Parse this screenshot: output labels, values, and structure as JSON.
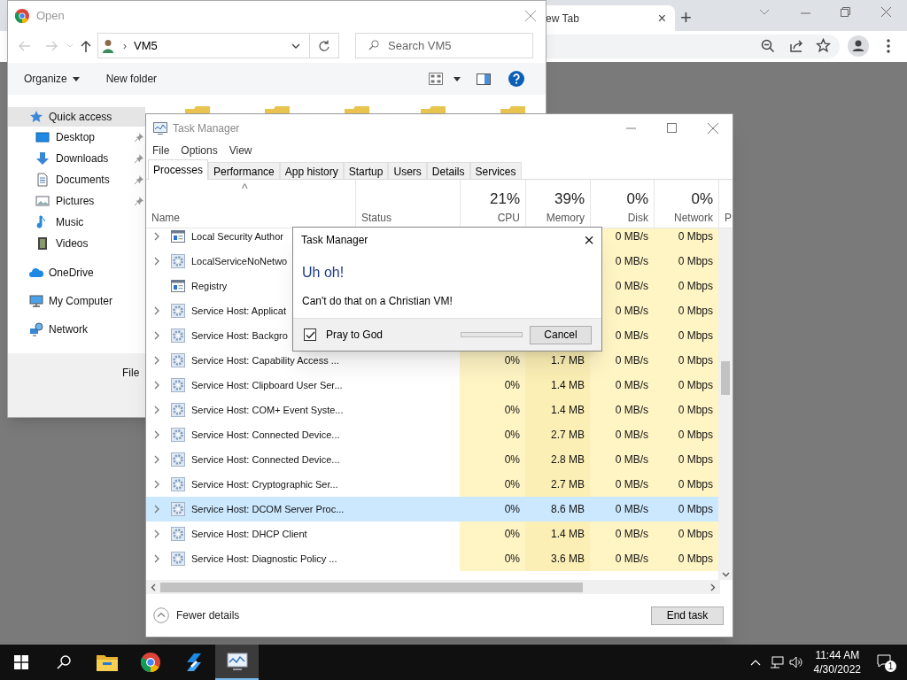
{
  "browser": {
    "tab_title": "ew Tab",
    "tab_close": "×",
    "new_tab": "+"
  },
  "open_dialog": {
    "title": "Open",
    "path_separator": "›",
    "path": "VM5",
    "search": {
      "placeholder": "Search VM5"
    },
    "commands": [
      "Organize",
      "New folder"
    ],
    "nav": [
      {
        "label": "Quick access",
        "kind": "star",
        "selected": true,
        "children": [
          {
            "label": "Desktop",
            "kind": "desktop",
            "pinned": true
          },
          {
            "label": "Downloads",
            "kind": "download",
            "pinned": true
          },
          {
            "label": "Documents",
            "kind": "document",
            "pinned": true
          },
          {
            "label": "Pictures",
            "kind": "picture",
            "pinned": true
          },
          {
            "label": "Music",
            "kind": "music",
            "pinned": false
          },
          {
            "label": "Videos",
            "kind": "video",
            "pinned": false
          }
        ]
      },
      {
        "label": "OneDrive",
        "kind": "cloud",
        "selected": false
      },
      {
        "label": "My Computer",
        "kind": "computer",
        "selected": false
      },
      {
        "label": "Network",
        "kind": "network",
        "selected": false
      }
    ],
    "file_name_label": "File"
  },
  "task_manager": {
    "title": "Task Manager",
    "menu": [
      "File",
      "Options",
      "View"
    ],
    "tabs": [
      {
        "label": "Processes",
        "selected": true
      },
      {
        "label": "Performance",
        "selected": false
      },
      {
        "label": "App history",
        "selected": false
      },
      {
        "label": "Startup",
        "selected": false
      },
      {
        "label": "Users",
        "selected": false
      },
      {
        "label": "Details",
        "selected": false
      },
      {
        "label": "Services",
        "selected": false
      }
    ],
    "sort_caret": "^",
    "columns": [
      {
        "label": "Name",
        "kind": "name"
      },
      {
        "label": "Status",
        "kind": "status"
      },
      {
        "label": "CPU",
        "usage": "21%",
        "kind": "cpu"
      },
      {
        "label": "Memory",
        "usage": "39%",
        "kind": "memory"
      },
      {
        "label": "Disk",
        "usage": "0%",
        "kind": "disk"
      },
      {
        "label": "Network",
        "usage": "0%",
        "kind": "network"
      },
      {
        "label": "P",
        "kind": "cut"
      }
    ],
    "rows": [
      {
        "name": "Local Security Author",
        "kind": "window",
        "expandable": true,
        "selected": false,
        "disk": "0 MB/s",
        "network": "0 Mbps"
      },
      {
        "name": "LocalServiceNoNetwo",
        "kind": "service",
        "expandable": true,
        "selected": false,
        "disk": "0 MB/s",
        "network": "0 Mbps"
      },
      {
        "name": "Registry",
        "kind": "window",
        "expandable": false,
        "selected": false,
        "disk": "0 MB/s",
        "network": "0 Mbps"
      },
      {
        "name": "Service Host: Applicat",
        "kind": "service",
        "expandable": true,
        "selected": false,
        "disk": "0 MB/s",
        "network": "0 Mbps"
      },
      {
        "name": "Service Host: Backgro",
        "kind": "service",
        "expandable": true,
        "selected": false,
        "disk": "0 MB/s",
        "network": "0 Mbps"
      },
      {
        "name": "Service Host: Capability Access ...",
        "kind": "service",
        "expandable": true,
        "selected": false,
        "cpu": "0%",
        "memory": "1.7 MB",
        "disk": "0 MB/s",
        "network": "0 Mbps"
      },
      {
        "name": "Service Host: Clipboard User Ser...",
        "kind": "service",
        "expandable": true,
        "selected": false,
        "cpu": "0%",
        "memory": "1.4 MB",
        "disk": "0 MB/s",
        "network": "0 Mbps"
      },
      {
        "name": "Service Host: COM+ Event Syste...",
        "kind": "service",
        "expandable": true,
        "selected": false,
        "cpu": "0%",
        "memory": "1.4 MB",
        "disk": "0 MB/s",
        "network": "0 Mbps"
      },
      {
        "name": "Service Host: Connected Device...",
        "kind": "service",
        "expandable": true,
        "selected": false,
        "cpu": "0%",
        "memory": "2.7 MB",
        "disk": "0 MB/s",
        "network": "0 Mbps"
      },
      {
        "name": "Service Host: Connected Device...",
        "kind": "service",
        "expandable": true,
        "selected": false,
        "cpu": "0%",
        "memory": "2.8 MB",
        "disk": "0 MB/s",
        "network": "0 Mbps"
      },
      {
        "name": "Service Host: Cryptographic Ser...",
        "kind": "service",
        "expandable": true,
        "selected": false,
        "cpu": "0%",
        "memory": "2.7 MB",
        "disk": "0 MB/s",
        "network": "0 Mbps"
      },
      {
        "name": "Service Host: DCOM Server Proc...",
        "kind": "service",
        "expandable": true,
        "selected": true,
        "cpu": "0%",
        "memory": "8.6 MB",
        "disk": "0 MB/s",
        "network": "0 Mbps"
      },
      {
        "name": "Service Host: DHCP Client",
        "kind": "service",
        "expandable": true,
        "selected": false,
        "cpu": "0%",
        "memory": "1.4 MB",
        "disk": "0 MB/s",
        "network": "0 Mbps"
      },
      {
        "name": "Service Host: Diagnostic Policy ...",
        "kind": "service",
        "expandable": true,
        "selected": false,
        "cpu": "0%",
        "memory": "3.6 MB",
        "disk": "0 MB/s",
        "network": "0 Mbps"
      }
    ],
    "fewer_details": "Fewer details",
    "end_task": "End task"
  },
  "dialog": {
    "title": "Task Manager",
    "close": "×",
    "heading": "Uh oh!",
    "message": "Can't do that on a Christian VM!",
    "checkbox": {
      "label": "Pray to God",
      "checked": true
    },
    "progress": {
      "level": 0
    },
    "button": "Cancel"
  },
  "taskbar": {
    "apps": [
      {
        "kind": "explorer",
        "active": false
      },
      {
        "kind": "chrome",
        "active": false
      },
      {
        "kind": "wrench",
        "active": false
      },
      {
        "kind": "taskmanager",
        "active": true
      }
    ],
    "time": "11:44 AM",
    "date": "4/30/2022",
    "notifications": "1"
  }
}
